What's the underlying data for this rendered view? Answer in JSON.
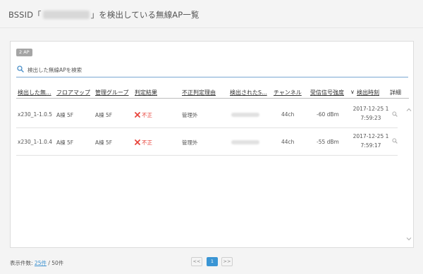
{
  "header": {
    "title_prefix": "BSSID「",
    "title_suffix": "」を検出している無線AP一覧"
  },
  "panel": {
    "count_badge": "2 AP",
    "search_placeholder": "検出した無線APを検索"
  },
  "table": {
    "columns": [
      "検出した無...",
      "フロアマップ",
      "管理グループ",
      "判定結果",
      "不正判定理由",
      "検出されたS...",
      "チャンネル",
      "受信信号強度",
      "検出時刻",
      "詳細"
    ],
    "sort_indicator": "∨",
    "rows": [
      {
        "ap_name": "x230_1-1.0.5",
        "floor_map": "A棟 5F",
        "group": "A棟 5F",
        "result": "不正",
        "reason": "管理外",
        "channel": "44ch",
        "rssi": "-60 dBm",
        "date": "2017-12-25 1",
        "time": "7:59:23"
      },
      {
        "ap_name": "x230_1-1.0.4",
        "floor_map": "A棟 5F",
        "group": "A棟 5F",
        "result": "不正",
        "reason": "管理外",
        "channel": "44ch",
        "rssi": "-55 dBm",
        "date": "2017-12-25 1",
        "time": "7:59:17"
      }
    ]
  },
  "footer": {
    "label": "表示件数: ",
    "per_page": "25件",
    "separator": " / ",
    "total": "50件"
  },
  "pager": {
    "prev": "<<",
    "current": "1",
    "next": ">>"
  },
  "colors": {
    "accent": "#3a95d4",
    "danger": "#e8453c",
    "search_underline": "#7aa8d2"
  }
}
